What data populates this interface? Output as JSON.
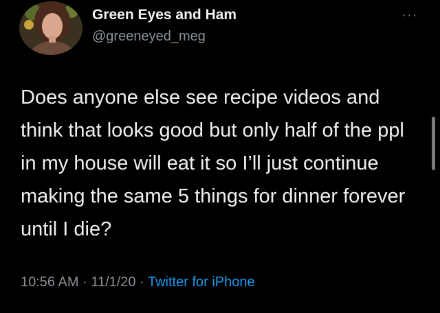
{
  "tweet": {
    "display_name": "Green Eyes and Ham",
    "handle": "@greeneyed_meg",
    "more_icon": "···",
    "text": "Does anyone else see recipe videos and think that looks good but only half of the ppl in my house will eat it so I’ll just continue making the same 5 things for dinner forever until I die?",
    "time": "10:56 AM",
    "date": "11/1/20",
    "separator": "·",
    "source": "Twitter for iPhone"
  },
  "colors": {
    "background": "#000000",
    "link": "#1d9bf0",
    "secondary_text": "#8b9197"
  }
}
